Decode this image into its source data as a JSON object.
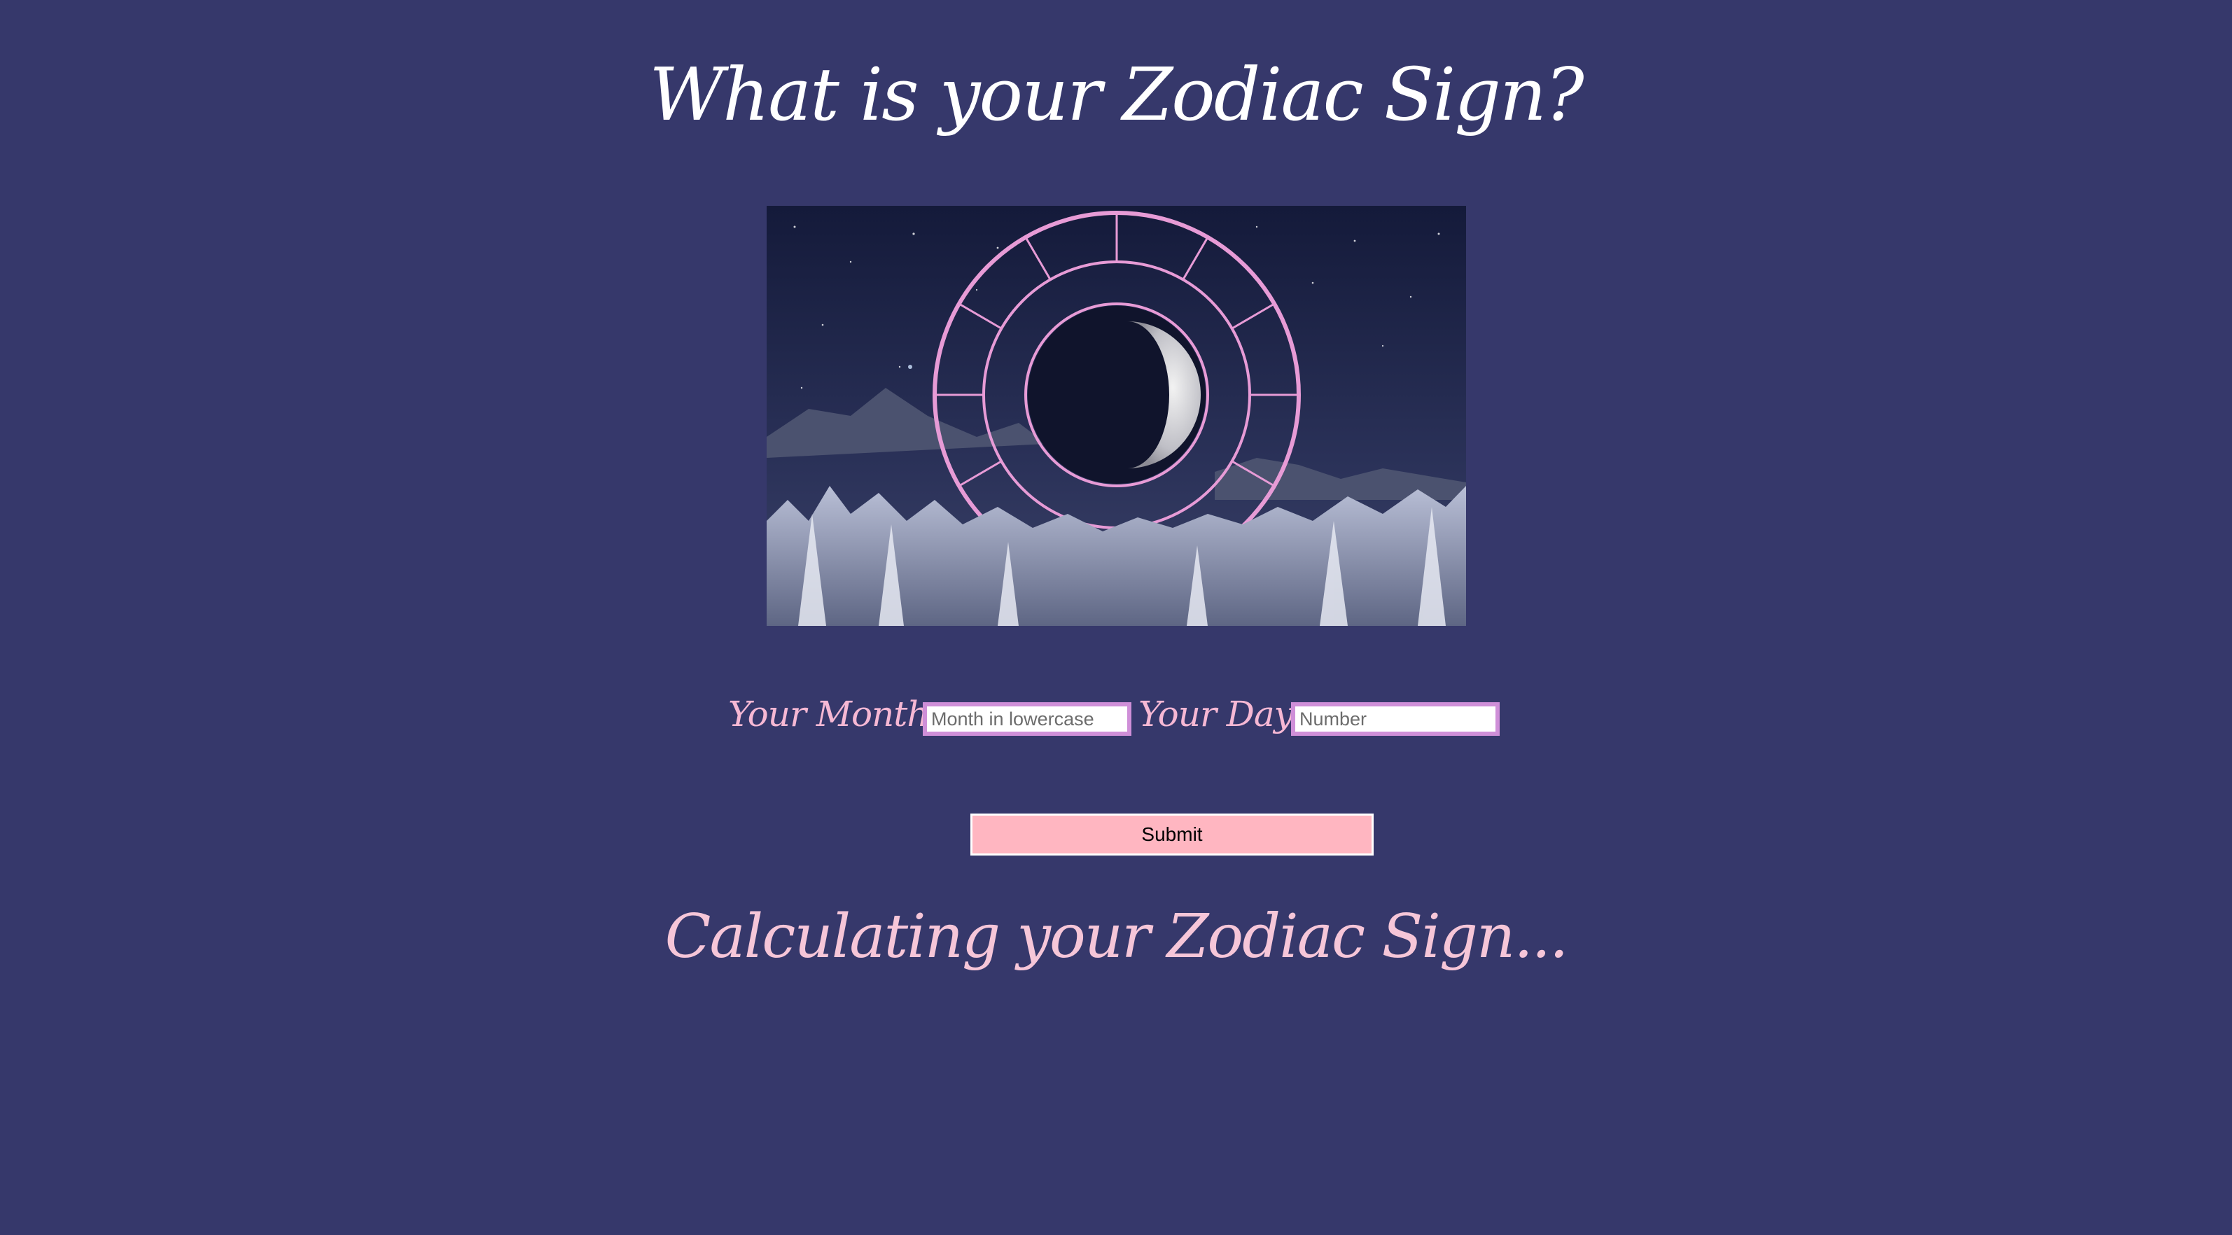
{
  "page": {
    "title": "What is your Zodiac Sign?",
    "result_text": "Calculating your Zodiac Sign...",
    "background_color": "#36386b"
  },
  "hero_image": {
    "description_icon": "zodiac-wheel-night-sky-image"
  },
  "form": {
    "month_label": "Your Month",
    "month_placeholder": "Month in lowercase",
    "month_value": "",
    "day_label": "Your Day",
    "day_placeholder": "Number",
    "day_value": "",
    "submit_label": "Submit"
  },
  "colors": {
    "label_pink": "#f6b8d4",
    "button_pink": "#ffb6c1",
    "field_border": "#cf8fd8",
    "wheel_pink": "#e79bd6"
  }
}
